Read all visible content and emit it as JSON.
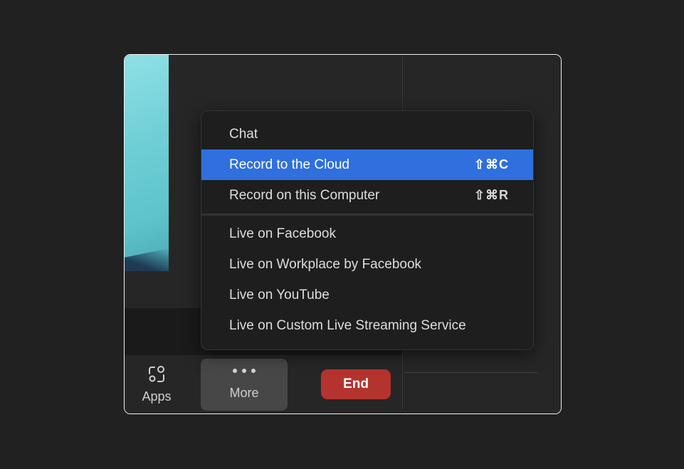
{
  "toolbar": {
    "apps_label": "Apps",
    "more_label": "More",
    "end_label": "End"
  },
  "menu": {
    "items": [
      {
        "label": "Chat",
        "shortcut": ""
      },
      {
        "label": "Record to the Cloud",
        "shortcut": "⇧⌘C",
        "highlighted": true
      },
      {
        "label": "Record on this Computer",
        "shortcut": "⇧⌘R"
      },
      {
        "label": "Live on Facebook",
        "shortcut": ""
      },
      {
        "label": "Live on Workplace by Facebook",
        "shortcut": ""
      },
      {
        "label": "Live on YouTube",
        "shortcut": ""
      },
      {
        "label": "Live on Custom Live Streaming Service",
        "shortcut": ""
      }
    ]
  },
  "icons": {
    "apps": "apps-icon",
    "more": "ellipsis-icon"
  },
  "colors": {
    "highlight": "#2f6fde",
    "end_button": "#b5332e",
    "background": "#212121",
    "menu_bg": "#1e1e1e"
  }
}
